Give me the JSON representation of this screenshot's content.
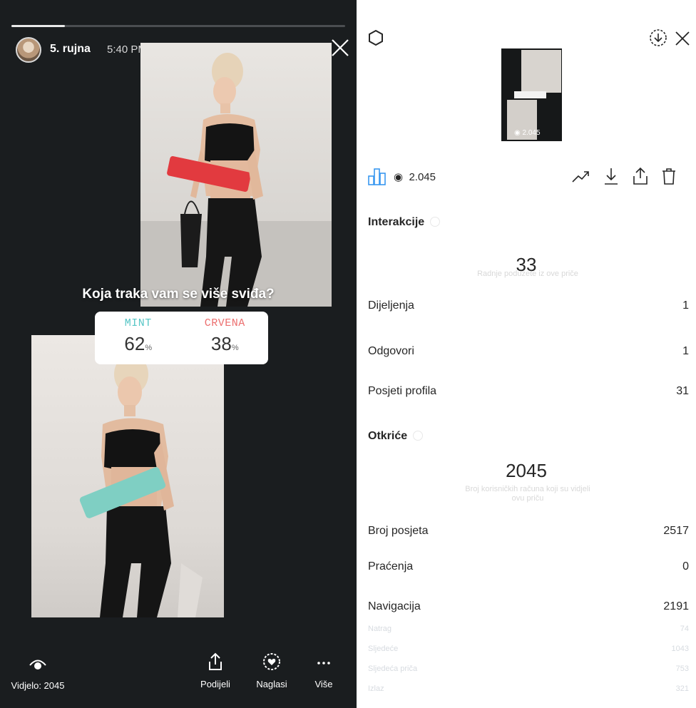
{
  "story": {
    "progress": 0.16,
    "date": "5. rujna",
    "time": "5:40 PM",
    "poll": {
      "question": "Koja traka vam se više sviđa?",
      "options": [
        {
          "label": "MINT",
          "pct": "62",
          "unit": "%",
          "color": "#57c6c6"
        },
        {
          "label": "CRVENA",
          "pct": "38",
          "unit": "%",
          "color": "#ec6f6f"
        }
      ]
    },
    "bottom": {
      "seen_label": "Vidjelo: 2045",
      "share_label": "Podijeli",
      "highlight_label": "Naglasi",
      "more_label": "Više"
    }
  },
  "insights": {
    "thumbnail_views": "2.045",
    "views": "2.045",
    "accent": "#3897f0",
    "interactions": {
      "title": "Interakcije",
      "total": "33",
      "caption": "Radnje poduzete iz ove priče",
      "rows": [
        {
          "label": "Dijeljenja",
          "value": "1"
        },
        {
          "label": "Odgovori",
          "value": "1"
        },
        {
          "label": "Posjeti profila",
          "value": "31"
        }
      ]
    },
    "discovery": {
      "title": "Otkriće",
      "total": "2045",
      "caption_line1": "Broj korisničkih računa koji su vidjeli",
      "caption_line2": "ovu priču",
      "rows": [
        {
          "label": "Broj posjeta",
          "value": "2517"
        },
        {
          "label": "Praćenja",
          "value": "0"
        },
        {
          "label": "Navigacija",
          "value": "2191"
        }
      ],
      "subrows": [
        {
          "label": "Natrag",
          "value": "74"
        },
        {
          "label": "Sljedeće",
          "value": "1043"
        },
        {
          "label": "Sljedeća priča",
          "value": "753"
        },
        {
          "label": "Izlaz",
          "value": "321"
        }
      ]
    }
  }
}
